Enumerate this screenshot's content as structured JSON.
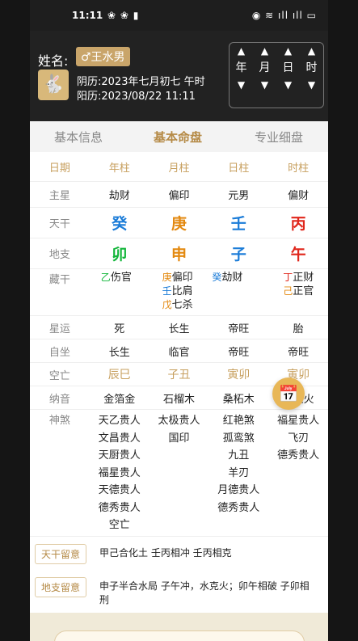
{
  "status": {
    "time": "11:11",
    "left_icons": "❀ ❀ ▮",
    "right_icons": "◉ ≋ ıll ıll ▭"
  },
  "header": {
    "name_label": "姓名:",
    "name_value": "♂王水男",
    "lunar": "阴历:2023年七月初七 午时",
    "solar": "阳历:2023/08/22 11:11",
    "controls": {
      "up": "▲",
      "down": "▼",
      "labels": [
        "年",
        "月",
        "日",
        "时"
      ]
    }
  },
  "tabs": [
    "基本信息",
    "基本命盘",
    "专业细盘"
  ],
  "grid": {
    "header": [
      "日期",
      "年柱",
      "月柱",
      "日柱",
      "时柱"
    ],
    "zhuxing": {
      "label": "主星",
      "values": [
        "劫财",
        "偏印",
        "元男",
        "偏财"
      ]
    },
    "tiangan": {
      "label": "天干",
      "values": [
        "癸",
        "庚",
        "壬",
        "丙"
      ]
    },
    "dizhi": {
      "label": "地支",
      "values": [
        "卯",
        "申",
        "子",
        "午"
      ]
    },
    "canggan": {
      "label": "藏干",
      "cols": [
        [
          {
            "g": "乙",
            "s": "伤官"
          }
        ],
        [
          {
            "g": "庚",
            "s": "偏印"
          },
          {
            "g": "壬",
            "s": "比肩"
          },
          {
            "g": "戊",
            "s": "七杀"
          }
        ],
        [
          {
            "g": "癸",
            "s": "劫财"
          }
        ],
        [
          {
            "g": "丁",
            "s": "正财"
          },
          {
            "g": "己",
            "s": "正官"
          }
        ]
      ]
    },
    "xingyun": {
      "label": "星运",
      "values": [
        "死",
        "长生",
        "帝旺",
        "胎"
      ]
    },
    "zizuo": {
      "label": "自坐",
      "values": [
        "长生",
        "临官",
        "帝旺",
        "帝旺"
      ]
    },
    "kongwang": {
      "label": "空亡",
      "values": [
        "辰巳",
        "子丑",
        "寅卯",
        "寅卯"
      ]
    },
    "nayin": {
      "label": "纳音",
      "values": [
        "金箔金",
        "石榴木",
        "桑柘木",
        "天上火"
      ]
    },
    "shensha": {
      "label": "神煞",
      "cols": [
        [
          "天乙贵人",
          "文昌贵人",
          "天厨贵人",
          "福星贵人",
          "天德贵人",
          "德秀贵人",
          "空亡"
        ],
        [
          "太极贵人",
          "国印"
        ],
        [
          "红艳煞",
          "孤鸾煞",
          "九丑",
          "羊刃",
          "月德贵人",
          "德秀贵人"
        ],
        [
          "福星贵人",
          "飞刃",
          "德秀贵人"
        ]
      ]
    }
  },
  "notes": [
    {
      "label": "天干留意",
      "text": "甲己合化土  壬丙相冲  壬丙相克"
    },
    {
      "label": "地支留意",
      "text": "申子半合水局  子午冲，水克火；卯午相破  子卯相刑"
    }
  ],
  "fab_icon": "calendar-clock-icon",
  "colors": {
    "gold": "#c79f5e",
    "wood": "#12b63a",
    "metal": "#e38910",
    "water": "#1b7cd8",
    "fire": "#e0261b"
  }
}
